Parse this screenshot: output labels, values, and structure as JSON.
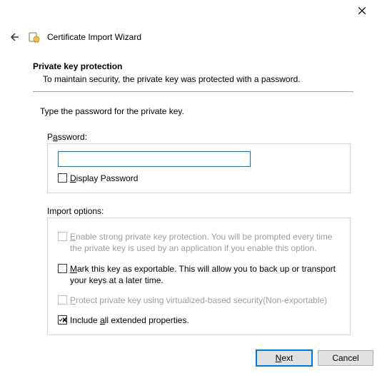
{
  "window": {
    "title": "Certificate Import Wizard"
  },
  "page": {
    "heading": "Private key protection",
    "subheading": "To maintain security, the private key was protected with a password.",
    "instruction": "Type the password for the private key."
  },
  "password_group": {
    "label_pre": "P",
    "label_ul": "a",
    "label_post": "ssword:",
    "value": "",
    "display_pw_ul": "D",
    "display_pw_post": "isplay Password",
    "display_pw_checked": false
  },
  "import_group": {
    "label": "Import options:",
    "opts": [
      {
        "ul": "E",
        "post": "nable strong private key protection. You will be prompted every time the private key is used by an application if you enable this option.",
        "checked": false,
        "disabled": true
      },
      {
        "ul": "M",
        "post": "ark this key as exportable. This will allow you to back up or transport your keys at a later time.",
        "checked": false,
        "disabled": false
      },
      {
        "ul": "P",
        "post": "rotect private key using virtualized-based security(Non-exportable)",
        "checked": false,
        "disabled": true
      },
      {
        "pre": "Include ",
        "ul": "a",
        "post": "ll extended properties.",
        "checked": true,
        "disabled": false
      }
    ]
  },
  "buttons": {
    "next_ul": "N",
    "next_post": "ext",
    "cancel": "Cancel"
  }
}
